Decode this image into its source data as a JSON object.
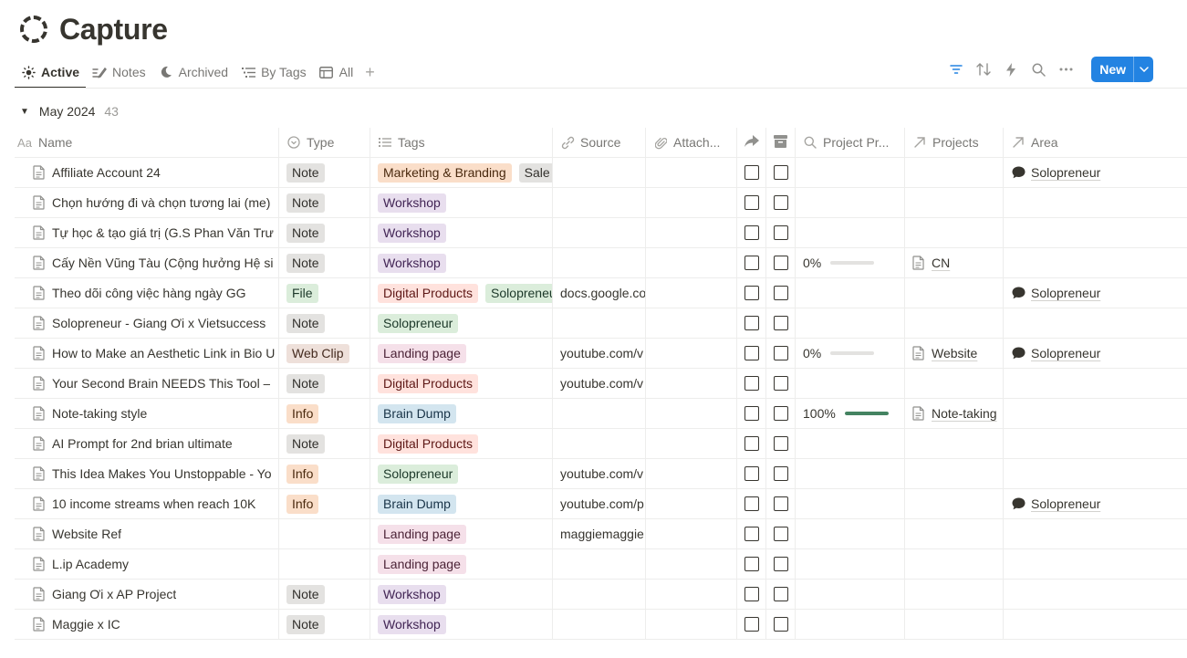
{
  "page": {
    "title": "Capture",
    "icon": "dashed-circle-icon"
  },
  "views": [
    {
      "label": "Active",
      "icon": "sun-icon",
      "active": true
    },
    {
      "label": "Notes",
      "icon": "pencil-icon",
      "active": false
    },
    {
      "label": "Archived",
      "icon": "moon-icon",
      "active": false
    },
    {
      "label": "By Tags",
      "icon": "list-icon",
      "active": false
    },
    {
      "label": "All",
      "icon": "table-icon",
      "active": false
    }
  ],
  "toolbar": {
    "new_label": "New"
  },
  "group": {
    "label": "May 2024",
    "count": "43"
  },
  "columns": {
    "name": "Name",
    "type": "Type",
    "tags": "Tags",
    "source": "Source",
    "attach": "Attach...",
    "project_progress": "Project Pr...",
    "projects": "Projects",
    "area": "Area"
  },
  "colors": {
    "accent": "#2383e2",
    "progress": "#448361"
  },
  "tag_styles": {
    "Marketing & Branding": {
      "bg": "#fadec9",
      "fg": "#49290e"
    },
    "Sale": {
      "bg": "#e3e2e0",
      "fg": "#32302c"
    },
    "Workshop": {
      "bg": "#e8deee",
      "fg": "#412454"
    },
    "Digital Products": {
      "bg": "#ffe2dd",
      "fg": "#5d1715"
    },
    "Solopreneur": {
      "bg": "#dbeddb",
      "fg": "#1c3829"
    },
    "Landing page": {
      "bg": "#f5e0e9",
      "fg": "#4c2337"
    },
    "Brain Dump": {
      "bg": "#d3e5ef",
      "fg": "#183347"
    }
  },
  "type_styles": {
    "Note": {
      "bg": "#e3e2e0",
      "fg": "#32302c"
    },
    "File": {
      "bg": "#dbeddb",
      "fg": "#1c3829"
    },
    "Web Clip": {
      "bg": "#eee0da",
      "fg": "#442a1e"
    },
    "Info": {
      "bg": "#fadec9",
      "fg": "#49290e"
    }
  },
  "rows": [
    {
      "name": "Affiliate Account 24",
      "type": "Note",
      "tags": [
        "Marketing & Branding",
        "Sale"
      ],
      "source": "",
      "progress": null,
      "project": "",
      "area": "Solopreneur"
    },
    {
      "name": "Chọn hướng đi và chọn tương lai (me)",
      "type": "Note",
      "tags": [
        "Workshop"
      ],
      "source": "",
      "progress": null,
      "project": "",
      "area": ""
    },
    {
      "name": "Tự học & tạo giá trị (G.S Phan Văn Trư",
      "type": "Note",
      "tags": [
        "Workshop"
      ],
      "source": "",
      "progress": null,
      "project": "",
      "area": ""
    },
    {
      "name": "Cấy Nền Vũng Tàu (Cộng hưởng Hệ si",
      "type": "Note",
      "tags": [
        "Workshop"
      ],
      "source": "",
      "progress": 0,
      "progress_label": "0%",
      "project": "CN",
      "area": ""
    },
    {
      "name": "Theo dõi công việc hàng ngày GG",
      "type": "File",
      "tags": [
        "Digital Products",
        "Solopreneur"
      ],
      "source": "docs.google.co",
      "progress": null,
      "project": "",
      "area": "Solopreneur"
    },
    {
      "name": "Solopreneur - Giang Ơi x Vietsuccess",
      "type": "Note",
      "tags": [
        "Solopreneur"
      ],
      "source": "",
      "progress": null,
      "project": "",
      "area": ""
    },
    {
      "name": "How to Make an Aesthetic Link in Bio U",
      "type": "Web Clip",
      "tags": [
        "Landing page"
      ],
      "source": "youtube.com/v",
      "progress": 0,
      "progress_label": "0%",
      "project": "Website",
      "area": "Solopreneur"
    },
    {
      "name": "Your Second Brain NEEDS This Tool –",
      "type": "Note",
      "tags": [
        "Digital Products"
      ],
      "source": "youtube.com/v",
      "progress": null,
      "project": "",
      "area": ""
    },
    {
      "name": "Note-taking style",
      "type": "Info",
      "tags": [
        "Brain Dump"
      ],
      "source": "",
      "progress": 1,
      "progress_label": "100%",
      "project": "Note-taking",
      "area": ""
    },
    {
      "name": "AI Prompt for 2nd brian ultimate",
      "type": "Note",
      "tags": [
        "Digital Products"
      ],
      "source": "",
      "progress": null,
      "project": "",
      "area": ""
    },
    {
      "name": "This Idea Makes You Unstoppable - Yo",
      "type": "Info",
      "tags": [
        "Solopreneur"
      ],
      "source": "youtube.com/v",
      "progress": null,
      "project": "",
      "area": ""
    },
    {
      "name": "10 income streams when reach 10K",
      "type": "Info",
      "tags": [
        "Brain Dump"
      ],
      "source": "youtube.com/p",
      "progress": null,
      "project": "",
      "area": "Solopreneur"
    },
    {
      "name": "Website Ref",
      "type": "",
      "tags": [
        "Landing page"
      ],
      "source": "maggiemaggie",
      "progress": null,
      "project": "",
      "area": ""
    },
    {
      "name": "L.ip Academy",
      "type": "",
      "tags": [
        "Landing page"
      ],
      "source": "",
      "progress": null,
      "project": "",
      "area": ""
    },
    {
      "name": "Giang Ơi x AP Project",
      "type": "Note",
      "tags": [
        "Workshop"
      ],
      "source": "",
      "progress": null,
      "project": "",
      "area": ""
    },
    {
      "name": "Maggie x IC",
      "type": "Note",
      "tags": [
        "Workshop"
      ],
      "source": "",
      "progress": null,
      "project": "",
      "area": ""
    }
  ]
}
